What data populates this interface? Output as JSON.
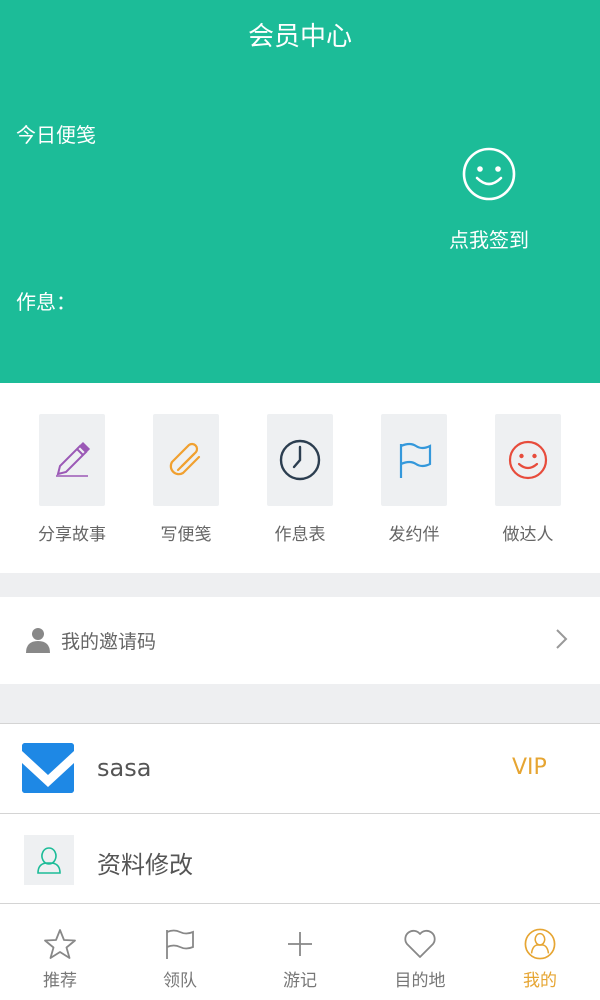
{
  "header": {
    "title": "会员中心",
    "note_label": "今日便笺",
    "schedule_label": "作息：",
    "signin_label": "点我签到"
  },
  "quick_actions": [
    {
      "label": "分享故事",
      "icon": "pencil-icon",
      "color": "#9b59b6"
    },
    {
      "label": "写便笺",
      "icon": "paperclip-icon",
      "color": "#f0a030"
    },
    {
      "label": "作息表",
      "icon": "clock-icon",
      "color": "#2c3e50"
    },
    {
      "label": "发约伴",
      "icon": "flag-icon",
      "color": "#3498db"
    },
    {
      "label": "做达人",
      "icon": "smile-icon",
      "color": "#e74c3c"
    }
  ],
  "invite": {
    "label": "我的邀请码"
  },
  "profile": {
    "username": "sasa",
    "badge": "VIP",
    "edit_label": "资料修改"
  },
  "tabs": [
    {
      "label": "推荐",
      "icon": "star-icon"
    },
    {
      "label": "领队",
      "icon": "flag-icon"
    },
    {
      "label": "游记",
      "icon": "plus-icon"
    },
    {
      "label": "目的地",
      "icon": "heart-icon"
    },
    {
      "label": "我的",
      "icon": "user-circle-icon",
      "active": true
    }
  ],
  "colors": {
    "header_bg": "#1cbc98",
    "accent": "#e6a532",
    "page_bg": "#eeeff1"
  }
}
